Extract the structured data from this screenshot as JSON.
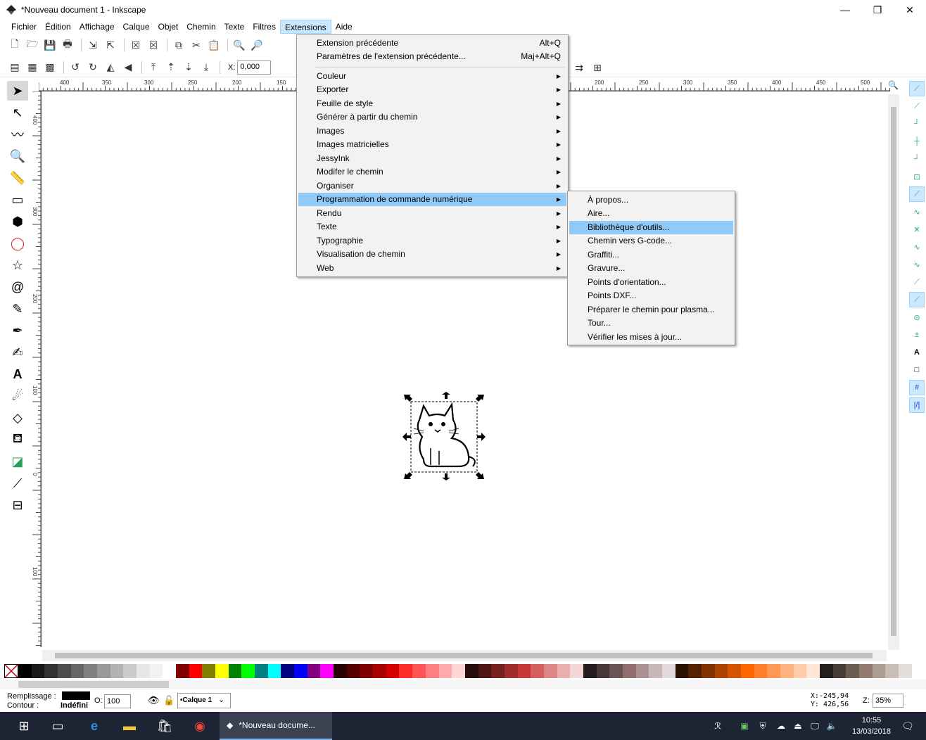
{
  "window": {
    "title": "*Nouveau document 1 - Inkscape",
    "minimize": "—",
    "maximize": "❐",
    "close": "✕"
  },
  "menubar": [
    "Fichier",
    "Édition",
    "Affichage",
    "Calque",
    "Objet",
    "Chemin",
    "Texte",
    "Filtres",
    "Extensions",
    "Aide"
  ],
  "toolbar2": {
    "x_label": "X:",
    "x_value": "0,000"
  },
  "rulers": {
    "h": [
      "400",
      "350",
      "300",
      "250",
      "200",
      "150",
      "200",
      "250",
      "300",
      "350",
      "400",
      "450",
      "500"
    ],
    "v": [
      "400",
      "300",
      "200",
      "100",
      "0",
      "100"
    ]
  },
  "extensions_menu": {
    "top_items": [
      {
        "label": "Extension précédente",
        "shortcut": "Alt+Q"
      },
      {
        "label": "Paramètres de l'extension précédente...",
        "shortcut": "Maj+Alt+Q"
      }
    ],
    "items": [
      "Couleur",
      "Exporter",
      "Feuille de style",
      "Générer à partir du chemin",
      "Images",
      "Images matricielles",
      "JessyInk",
      "Modifer le chemin",
      "Organiser",
      "Programmation de commande numérique",
      "Rendu",
      "Texte",
      "Typographie",
      "Visualisation de chemin",
      "Web"
    ],
    "highlighted": "Programmation de commande numérique"
  },
  "submenu": {
    "items": [
      "À propos...",
      "Aire...",
      "Bibliothèque d'outils...",
      "Chemin vers G-code...",
      "Graffiti...",
      "Gravure...",
      "Points d'orientation...",
      "Points DXF...",
      "Préparer le chemin pour plasma...",
      "Tour...",
      "Vérifier les mises à jour..."
    ],
    "highlighted": "Bibliothèque d'outils..."
  },
  "statusbar": {
    "fill_label": "Remplissage :",
    "stroke_label": "Contour :",
    "stroke_value": "Indéfini",
    "opacity_label": "O:",
    "opacity_value": "100",
    "layer": "•Calque 1",
    "x_readout": "X:-245,94",
    "y_readout": "Y:  426,56",
    "zoom_label": "Z:",
    "zoom_value": "35%"
  },
  "taskbar": {
    "active_task": "*Nouveau docume...",
    "time": "10:55",
    "date": "13/03/2018"
  },
  "palette": [
    "#000000",
    "#1a1a1a",
    "#333333",
    "#4d4d4d",
    "#666666",
    "#808080",
    "#999999",
    "#b3b3b3",
    "#cccccc",
    "#e6e6e6",
    "#f2f2f2",
    "#ffffff",
    "#800000",
    "#ff0000",
    "#808000",
    "#ffff00",
    "#008000",
    "#00ff00",
    "#008080",
    "#00ffff",
    "#000080",
    "#0000ff",
    "#800080",
    "#ff00ff",
    "#2b0000",
    "#550000",
    "#800000",
    "#aa0000",
    "#d40000",
    "#ff2a2a",
    "#ff5555",
    "#ff8080",
    "#ffaaaa",
    "#ffd5d5",
    "#280b0b",
    "#501616",
    "#782121",
    "#a02c2c",
    "#c83737",
    "#d35f5f",
    "#de8787",
    "#e9afaf",
    "#f4d7d7",
    "#241c1c",
    "#483737",
    "#6c5353",
    "#916f6f",
    "#ac9393",
    "#c8b7b7",
    "#e3dbdb",
    "#2b1100",
    "#552200",
    "#803300",
    "#aa4400",
    "#d45500",
    "#ff6600",
    "#ff7f2a",
    "#ff9955",
    "#ffb380",
    "#ffccaa",
    "#ffe6d5",
    "#241f1c",
    "#483e37",
    "#6c5d53",
    "#917c6f",
    "#ac9d93",
    "#c8beb7",
    "#e3dedb"
  ]
}
